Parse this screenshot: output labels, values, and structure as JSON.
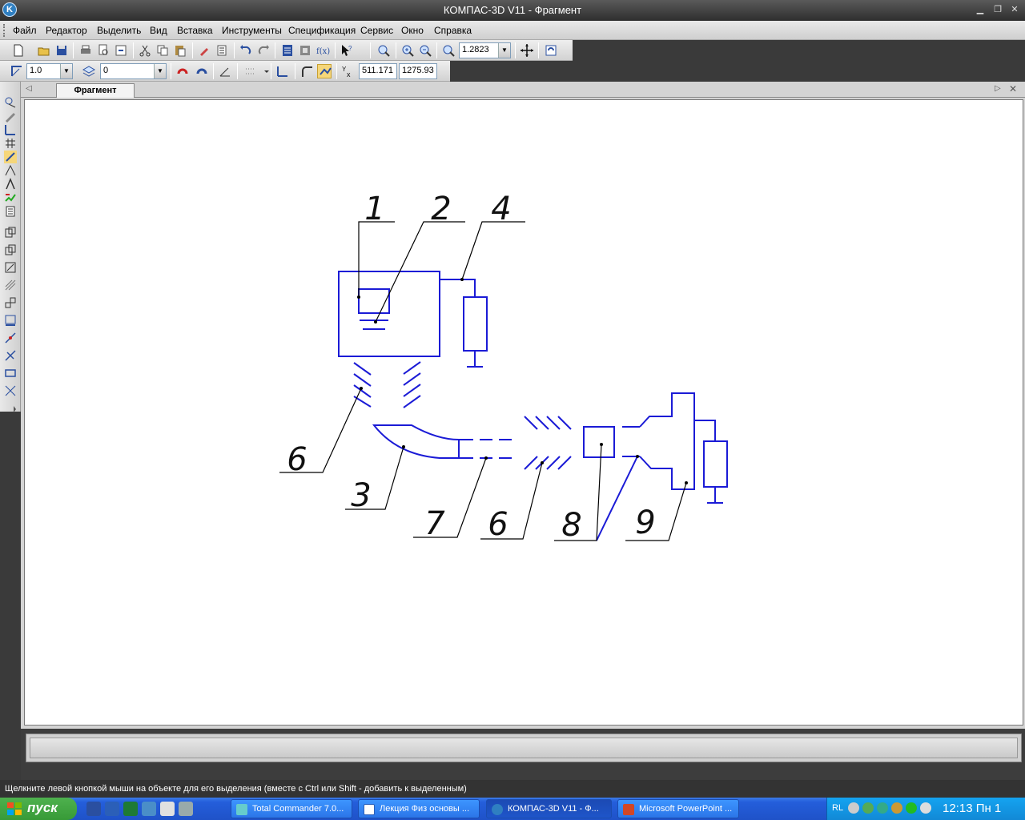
{
  "window": {
    "title": "КОМПАС-3D V11 - Фрагмент",
    "app_icon_letter": "K"
  },
  "menu": [
    "Файл",
    "Редактор",
    "Выделить",
    "Вид",
    "Вставка",
    "Инструменты",
    "Спецификация",
    "Сервис",
    "Окно",
    "Справка"
  ],
  "toolbar": {
    "zoom_value": "1.2823"
  },
  "toolbar2": {
    "step_value": "1.0",
    "layer_value": "0",
    "coord_x": "511.171",
    "coord_y": "1275.93"
  },
  "document": {
    "tab_label": "Фрагмент"
  },
  "drawing": {
    "leader_labels": [
      "1",
      "2",
      "4",
      "6",
      "3",
      "7",
      "6",
      "8",
      "9"
    ],
    "line_color": "#1b1bd6"
  },
  "status": {
    "hint": "Щелкните левой кнопкой мыши на объекте для его выделения (вместе с Ctrl или Shift - добавить к выделенным)"
  },
  "taskbar": {
    "start_label": "пуск",
    "tasks": [
      {
        "label": "Total Commander 7.0..."
      },
      {
        "label": "Лекция Физ основы ..."
      },
      {
        "label": "КОМПАС-3D V11 - Ф..."
      },
      {
        "label": "Microsoft PowerPoint ..."
      }
    ],
    "lang": "RL",
    "clock": "12:13 Пн 1"
  }
}
